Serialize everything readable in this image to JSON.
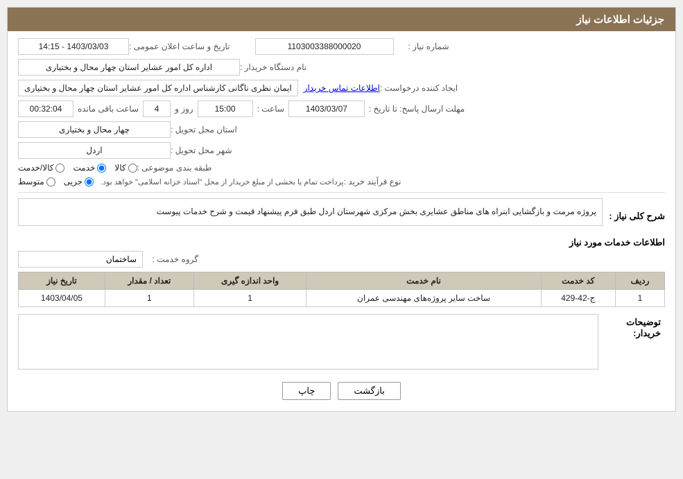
{
  "header": {
    "title": "جزئیات اطلاعات نیاز"
  },
  "fields": {
    "need_number_label": "شماره نیاز :",
    "need_number_value": "1103003388000020",
    "announce_label": "تاریخ و ساعت اعلان عمومی :",
    "announce_value": "1403/03/03 - 14:15",
    "buyer_org_label": "نام دستگاه خریدار :",
    "buyer_org_value": "اداره کل امور عشایر استان چهار محال و بختیاری",
    "creator_label": "ایجاد کننده درخواست :",
    "creator_value": "ایمان نظری ناگانی کارشناس اداره کل امور عشایر استان چهار محال و بختیاری",
    "contact_link": "اطلاعات تماس خریدار",
    "response_deadline_label": "مهلت ارسال پاسخ: تا تاریخ :",
    "response_date_value": "1403/03/07",
    "response_time_label": "ساعت :",
    "response_time_value": "15:00",
    "response_days_label": "روز و",
    "response_days_value": "4",
    "remaining_label": "ساعت باقی مانده",
    "remaining_value": "00:32:04",
    "province_label": "استان محل تحویل :",
    "province_value": "چهار محال و بختیاری",
    "city_label": "شهر محل تحویل :",
    "city_value": "اردل",
    "category_label": "طبقه بندی موضوعی :",
    "category_kala": "کالا",
    "category_khadamat": "خدمت",
    "category_kala_khadamat": "کالا/خدمت",
    "category_selected": "khadamat",
    "purchase_type_label": "نوع فرآیند خرید :",
    "purchase_jozi": "جزیی",
    "purchase_motavaset": "متوسط",
    "purchase_note": "پرداخت تمام یا بخشی از مبلغ خریدار از محل \"اسناد خزانه اسلامی\" خواهد بود.",
    "purchase_selected": "jozi",
    "description_label": "شرح کلی نیاز :",
    "description_text": "پروژه مرمت و بازگشایی ابنراه های مناطق عشایری بخش مرکزی شهرستان اردل طبق فرم پیشنهاد قیمت و شرح خدمات پیوست",
    "services_section_label": "اطلاعات خدمات مورد نیاز",
    "group_service_label": "گروه خدمت :",
    "group_service_value": "ساختمان",
    "table_headers": {
      "row_num": "ردیف",
      "service_code": "کد خدمت",
      "service_name": "نام خدمت",
      "unit": "واحد اندازه گیری",
      "quantity": "تعداد / مقدار",
      "delivery_date": "تاریخ نیاز"
    },
    "table_rows": [
      {
        "row_num": "1",
        "service_code": "ج-42-429",
        "service_name": "ساخت سایر پروژه‌های مهندسی عمران",
        "unit": "1",
        "quantity": "1",
        "delivery_date": "1403/04/05"
      }
    ],
    "buyer_notes_label": "توضیحات خریدار:",
    "buyer_notes_value": ""
  },
  "buttons": {
    "print_label": "چاپ",
    "back_label": "بازگشت"
  }
}
